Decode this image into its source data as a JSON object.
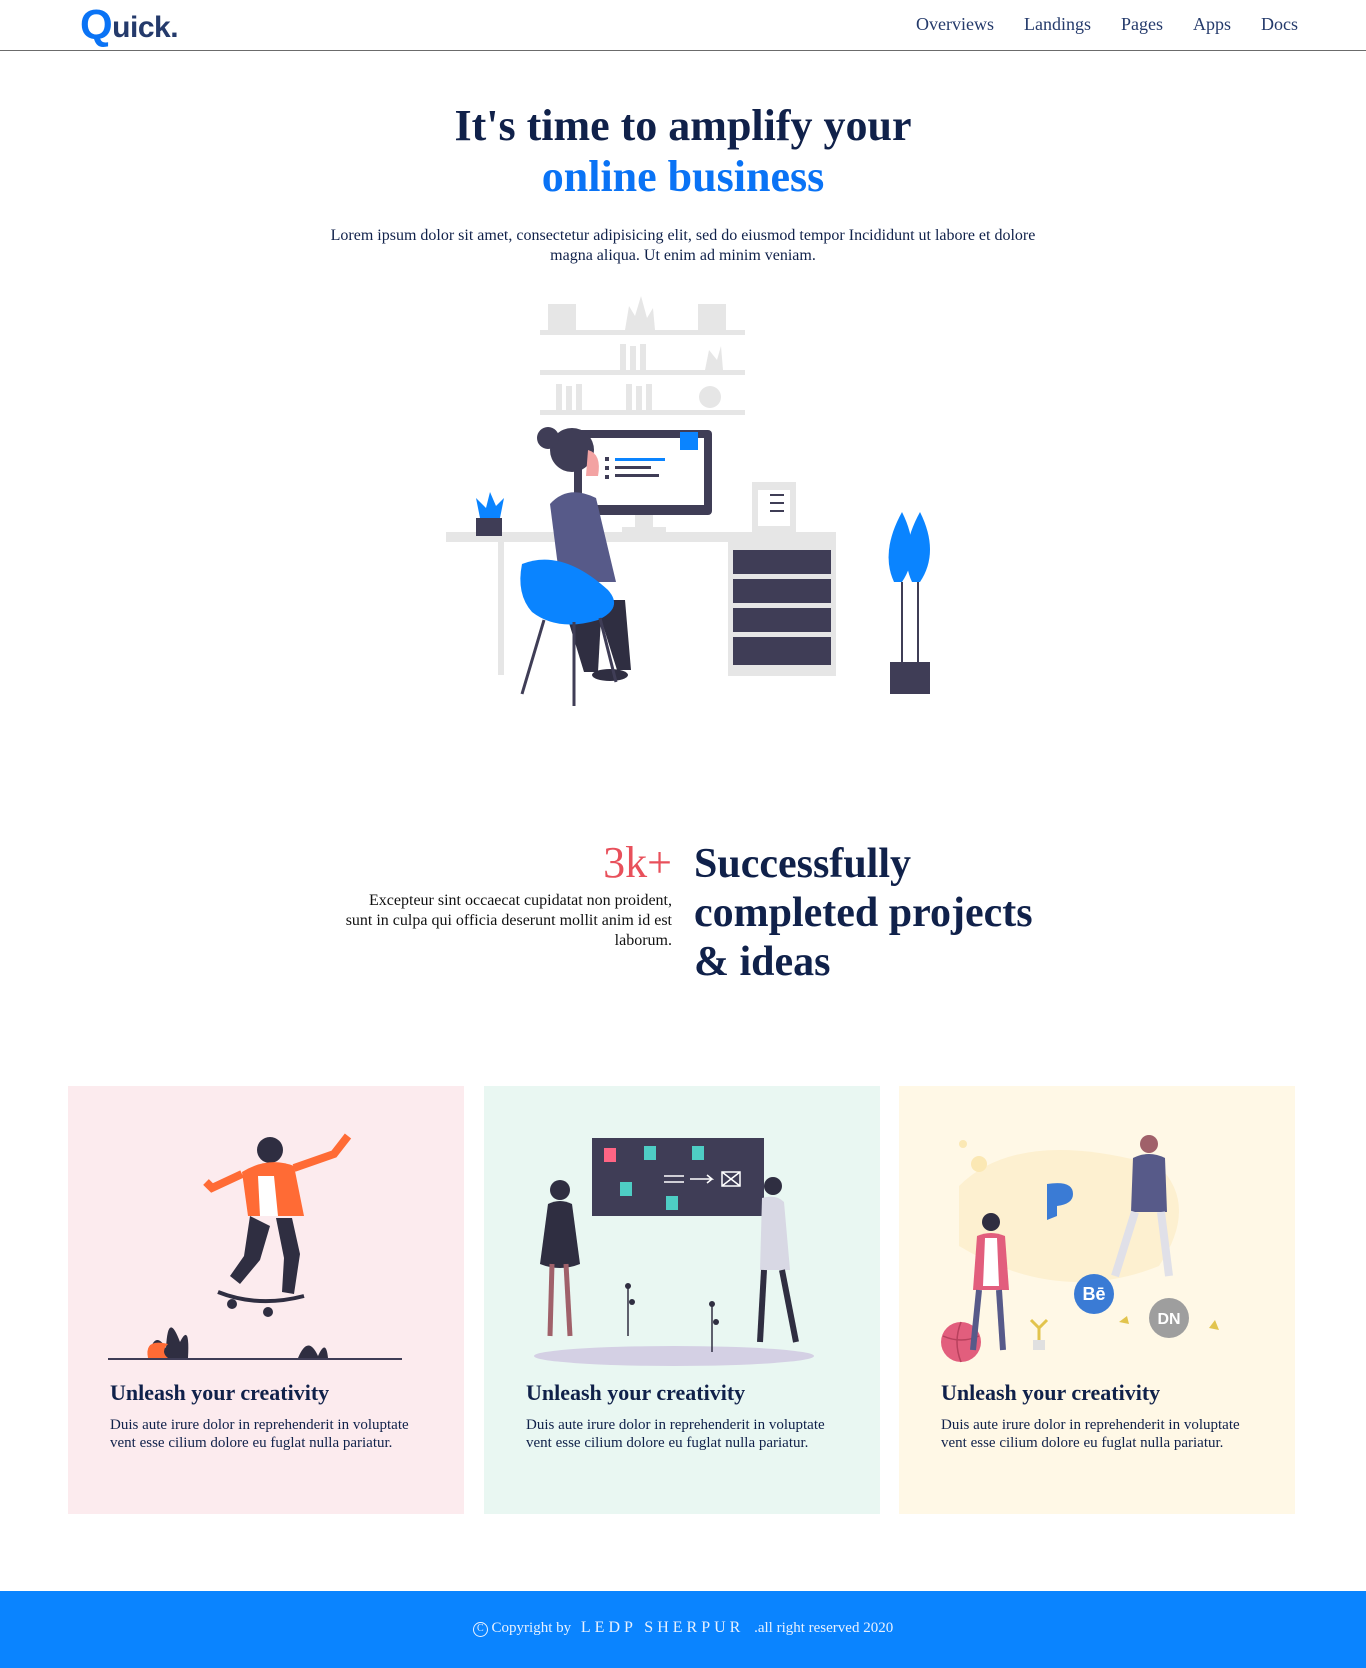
{
  "header": {
    "logo_first": "Q",
    "logo_rest": "uick.",
    "nav": [
      "Overviews",
      "Landings",
      "Pages",
      "Apps",
      "Docs"
    ]
  },
  "hero": {
    "title_line1": "It's time to amplify your",
    "title_line2": "online business",
    "subtitle": "Lorem ipsum dolor sit amet, consectetur adipisicing elit, sed do eiusmod tempor Incididunt ut labore et dolore magna aliqua. Ut enim ad minim veniam."
  },
  "stats": {
    "number": "3k+",
    "text": "Excepteur sint occaecat cupidatat non proident, sunt in culpa qui officia deserunt mollit anim id est laborum.",
    "heading": "Successfully completed projects & ideas"
  },
  "cards": [
    {
      "title": "Unleash your creativity",
      "text": "Duis aute irure dolor in reprehenderit in voluptate vent esse cilium dolore eu fuglat nulla pariatur."
    },
    {
      "title": "Unleash your creativity",
      "text": "Duis aute irure dolor in reprehenderit in voluptate vent esse cilium dolore eu fuglat nulla pariatur."
    },
    {
      "title": "Unleash your creativity",
      "text": "Duis aute irure dolor in reprehenderit in voluptate vent esse cilium dolore eu fuglat nulla pariatur."
    }
  ],
  "card_illustration_labels": {
    "behance": "Bē",
    "dn": "DN"
  },
  "footer": {
    "copyright_symbol": "C",
    "prefix": "Copyright by",
    "brand": "LEDP SHERPUR",
    "suffix": ".all right reserved 2020"
  },
  "colors": {
    "accent": "#0a73f5",
    "navy": "#10214a",
    "stat_red": "#e8505b",
    "footer_bg": "#0a84ff",
    "card_pink": "#fcebee",
    "card_mint": "#e9f7f2",
    "card_cream": "#fff8e6"
  }
}
